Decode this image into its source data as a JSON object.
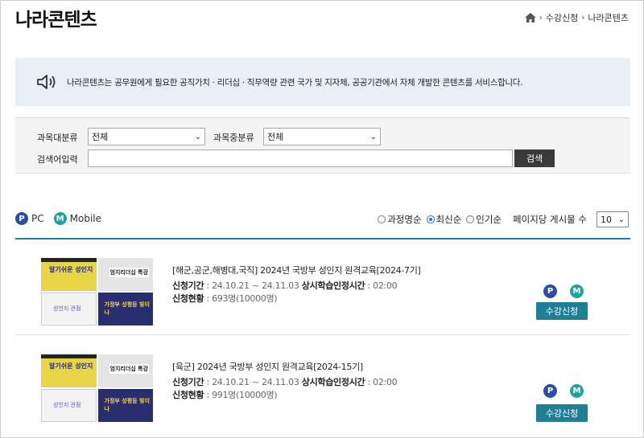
{
  "page": {
    "title": "나라콘텐츠"
  },
  "breadcrumb": {
    "items": [
      "수강신청",
      "나라콘텐츠"
    ]
  },
  "notice": {
    "text": "나라콘텐츠는 공무원에게 필요한 공직가치 · 리더십 · 직무역량 관련 국가 및 지자체, 공공기관에서 자체 개발한 콘텐츠를 서비스합니다."
  },
  "filter": {
    "major_label": "과목대분류",
    "major_value": "전체",
    "middle_label": "과목중분류",
    "middle_value": "전체",
    "search_label": "검색어입력",
    "search_value": "",
    "search_button": "검색"
  },
  "legend": {
    "pc_icon": "P",
    "pc_label": "PC",
    "mobile_icon": "M",
    "mobile_label": "Mobile"
  },
  "sort": {
    "options": [
      "과정명순",
      "최신순",
      "인기순"
    ],
    "selected": "최신순",
    "per_page_label": "페이지당 게시물 수",
    "per_page_value": "10"
  },
  "courses": [
    {
      "title": "[해군,공군,해병대,국직] 2024년 국방부 성인지 원격교육[2024-7기]",
      "period_label": "신청기간",
      "period_value": ": 24.10.21 ~ 24.11.03",
      "hours_label": "상시학습인정시간",
      "hours_value": ": 02:00",
      "status_label": "신청현황",
      "status_value": ": 693명(10000명)",
      "thumb_texts": [
        "알기쉬운 성인지",
        "엄지리더십 특강",
        "성인지 관점",
        "가정부 성평등 빛이나"
      ],
      "pc_badge": "P",
      "mobile_badge": "M",
      "enroll_label": "수강신청"
    },
    {
      "title": "[육군] 2024년 국방부 성인지 원격교육[2024-15기]",
      "period_label": "신청기간",
      "period_value": ": 24.10.21 ~ 24.11.03",
      "hours_label": "상시학습인정시간",
      "hours_value": ": 02:00",
      "status_label": "신청현황",
      "status_value": ": 991명(10000명)",
      "thumb_texts": [
        "알기쉬운 성인지",
        "엄지리더십 특강",
        "성인지 관점",
        "가정부 성평등 빛이나"
      ],
      "pc_badge": "P",
      "mobile_badge": "M",
      "enroll_label": "수강신청"
    }
  ],
  "colors": {
    "accent": "#1f7e98",
    "pc_badge": "#2b4ea3",
    "mobile_badge": "#1fa3a0",
    "notice_bg": "#e9eff7"
  }
}
